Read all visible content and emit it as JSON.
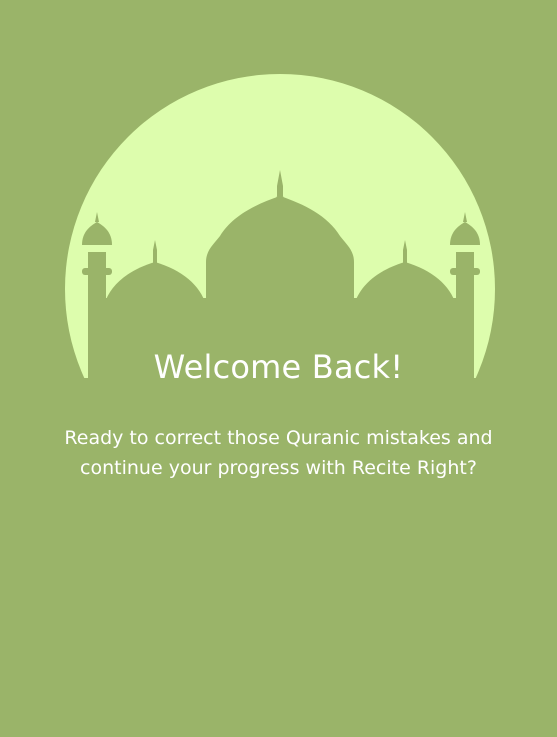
{
  "colors": {
    "background": "#9ab469",
    "moon": "#ddfdad",
    "silhouette": "#9ab469",
    "text": "#ffffff"
  },
  "hero": {
    "moon_icon": "crescent-moon-circle",
    "mosque_icon": "mosque-silhouette-icon"
  },
  "welcome": {
    "title": "Welcome Back!",
    "message": "Ready to correct those Quranic mistakes and continue your progress with Recite Right?"
  }
}
